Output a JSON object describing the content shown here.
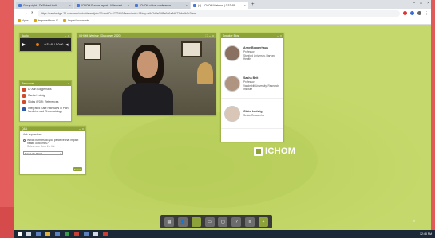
{
  "browser": {
    "tabs": [
      {
        "label": "Group right - Dr Robert Halt",
        "active": false
      },
      {
        "label": "ICHOM Europe report - Videocast",
        "active": false
      },
      {
        "label": "ICHOM virtual conference",
        "active": false
      },
      {
        "label": "(4) - ICHOM Webinar | 0:32:48",
        "active": true
      }
    ],
    "url": "https://cambridge-24.com/cms/virtual/eventjoin/?EventID=2723489&sessionid=1&key=a9a2d8e04f8e9a6a8db72efa8b1c29ce",
    "bookmarks": [
      "Apps",
      "Imported from IE",
      "Import bookmarks"
    ]
  },
  "panels": {
    "audio": {
      "title": "Audio",
      "time": "0:32:48 / 1:0:00"
    },
    "video": {
      "title": "ICHOM Webinar | Outcomes 2020"
    },
    "bios": {
      "title": "Speaker Bios",
      "speakers": [
        {
          "name": "Anne Boggerhaus",
          "role": "Professor",
          "org": "Stanford University, Harvard Health"
        },
        {
          "name": "Sasha Beit",
          "role": "Professor",
          "org": "Vanderbilt University, Research Institute"
        },
        {
          "name": "Claire Ludwig",
          "role": "Senior Researcher",
          "org": ""
        }
      ]
    },
    "resources": {
      "title": "Resources",
      "items": [
        "Dr Ann Boggerhaus",
        "Sasha Ludwig",
        "Slides (PDF): References",
        "Integrated Care Pathways in Pain Medicine and Rheumatology"
      ]
    },
    "qa": {
      "title": "Q&A",
      "intro": "Ask a question:",
      "question": "Which barriers do you perceive that impact health outcomes?",
      "sub": "Select one from the list",
      "select": "Select the PCOI",
      "submit": "Submit"
    }
  },
  "logo": {
    "text": "ICHOM"
  },
  "dock": {
    "buttons": [
      "slides",
      "people",
      "info",
      "share",
      "chat",
      "qa",
      "polls",
      "help"
    ]
  },
  "taskbar": {
    "clock": "12:48 PM"
  },
  "colors": {
    "accent": "#8da33a",
    "background": "#c5d86b",
    "red": "#e35d5d"
  }
}
